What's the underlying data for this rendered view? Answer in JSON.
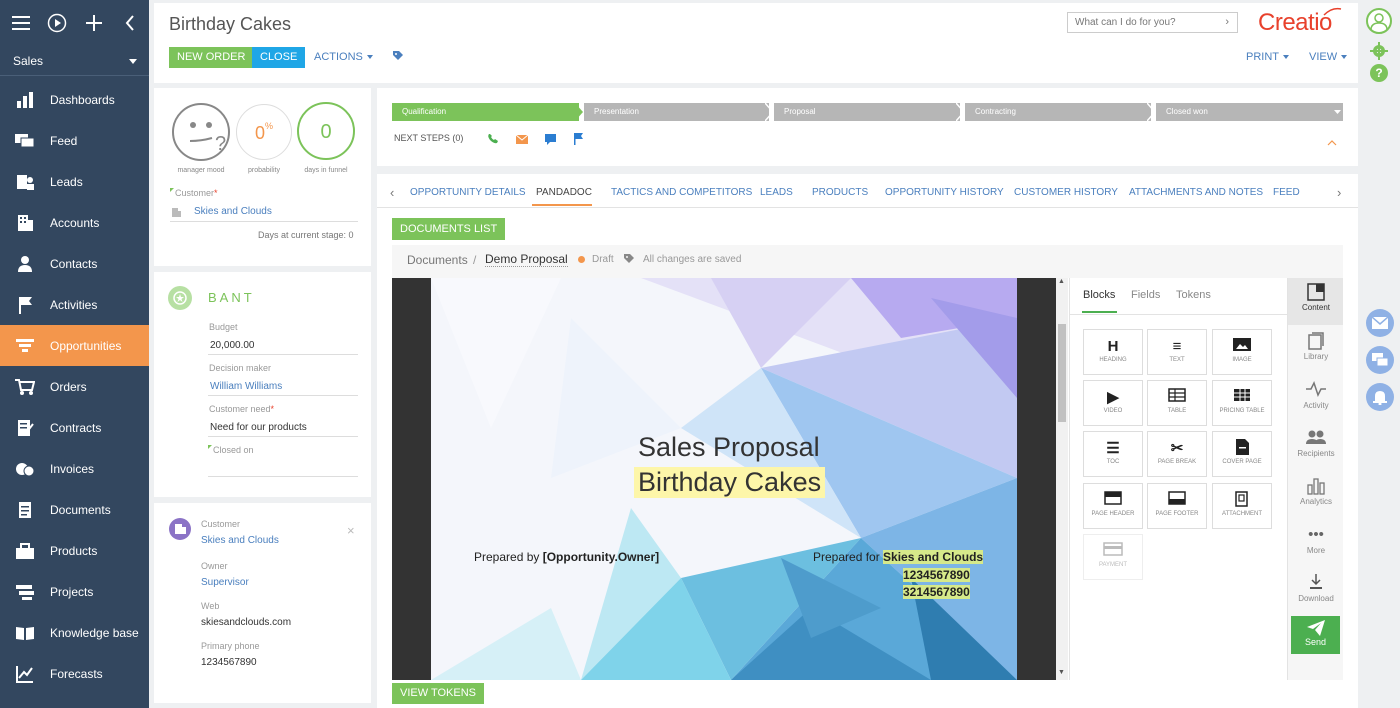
{
  "sidebar": {
    "workspace": "Sales",
    "items": [
      {
        "label": "Dashboards",
        "icon": "bar-chart-icon"
      },
      {
        "label": "Feed",
        "icon": "chat-icon"
      },
      {
        "label": "Leads",
        "icon": "leads-icon"
      },
      {
        "label": "Accounts",
        "icon": "building-icon"
      },
      {
        "label": "Contacts",
        "icon": "person-icon"
      },
      {
        "label": "Activities",
        "icon": "flag-icon"
      },
      {
        "label": "Opportunities",
        "icon": "funnel-icon"
      },
      {
        "label": "Orders",
        "icon": "cart-icon"
      },
      {
        "label": "Contracts",
        "icon": "contract-icon"
      },
      {
        "label": "Invoices",
        "icon": "coins-icon"
      },
      {
        "label": "Documents",
        "icon": "document-icon"
      },
      {
        "label": "Products",
        "icon": "box-icon"
      },
      {
        "label": "Projects",
        "icon": "projects-icon"
      },
      {
        "label": "Knowledge base",
        "icon": "book-icon"
      },
      {
        "label": "Forecasts",
        "icon": "forecast-icon"
      }
    ]
  },
  "header": {
    "title": "Birthday Cakes",
    "new_order": "NEW ORDER",
    "close": "CLOSE",
    "actions": "ACTIONS",
    "print": "PRINT",
    "view": "VIEW",
    "search_placeholder": "What can I do for you?",
    "logo": "Creatio"
  },
  "summary": {
    "mood_label": "manager mood",
    "probability_value": "0",
    "probability_unit": "%",
    "probability_label": "probability",
    "days_value": "0",
    "days_label": "days in funnel",
    "customer_label": "Customer",
    "customer_value": "Skies and Clouds",
    "days_at_stage": "Days at current stage: 0"
  },
  "bant": {
    "title": "BANT",
    "budget_label": "Budget",
    "budget_value": "20,000.00",
    "decision_maker_label": "Decision maker",
    "decision_maker_value": "William Williams",
    "customer_need_label": "Customer need",
    "customer_need_value": "Need for our products",
    "closed_on_label": "Closed on"
  },
  "customer_card": {
    "customer_label": "Customer",
    "customer_value": "Skies and Clouds",
    "owner_label": "Owner",
    "owner_value": "Supervisor",
    "web_label": "Web",
    "web_value": "skiesandclouds.com",
    "phone_label": "Primary phone",
    "phone_value": "1234567890"
  },
  "stages": [
    "Qualification",
    "Presentation",
    "Proposal",
    "Contracting",
    "Closed won"
  ],
  "next_steps": "NEXT STEPS (0)",
  "tabs": [
    "OPPORTUNITY DETAILS",
    "PANDADOC",
    "TACTICS AND COMPETITORS",
    "LEADS",
    "PRODUCTS",
    "OPPORTUNITY HISTORY",
    "CUSTOMER HISTORY",
    "ATTACHMENTS AND NOTES",
    "FEED"
  ],
  "pandadoc": {
    "documents_list": "DOCUMENTS LIST",
    "breadcrumb_root": "Documents",
    "doc_name": "Demo Proposal",
    "status": "Draft",
    "saved": "All changes are saved",
    "view_tokens": "VIEW TOKENS",
    "doc_title": "Sales Proposal",
    "doc_subtitle": "Birthday Cakes",
    "prepared_by_prefix": "Prepared by ",
    "prepared_by_token": "[Opportunity.Owner]",
    "prepared_for_prefix": "Prepared for ",
    "prepared_for_value": "Skies and Clouds",
    "phone1": "1234567890",
    "phone2": "3214567890",
    "panel_tabs": [
      "Blocks",
      "Fields",
      "Tokens"
    ],
    "blocks": [
      "HEADING",
      "TEXT",
      "IMAGE",
      "VIDEO",
      "TABLE",
      "PRICING TABLE",
      "TOC",
      "PAGE BREAK",
      "COVER PAGE",
      "PAGE HEADER",
      "PAGE FOOTER",
      "ATTACHMENT",
      "PAYMENT"
    ],
    "rail": [
      "Content",
      "Library",
      "Activity",
      "Recipients",
      "Analytics",
      "More",
      "Download",
      "Send"
    ]
  },
  "colors": {
    "sidebar": "#33475f",
    "active_nav": "#f3964c",
    "green": "#7cc35a",
    "blue": "#1fa6e6",
    "link": "#4a7fbe",
    "logo": "#e8412c"
  }
}
